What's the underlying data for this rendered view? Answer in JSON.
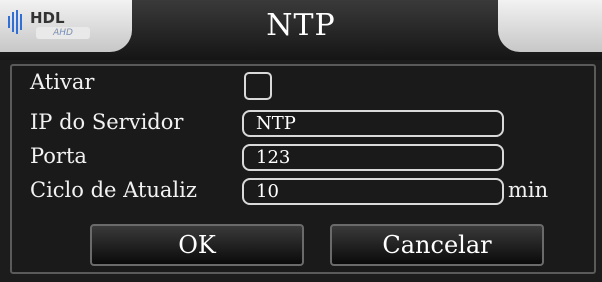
{
  "header": {
    "logo_text": "HDL",
    "logo_sub": "AHD",
    "title": "NTP"
  },
  "form": {
    "enable_label": "Ativar",
    "enable_checked": false,
    "server_label": "IP do Servidor",
    "server_value": "NTP",
    "port_label": "Porta",
    "port_value": "123",
    "cycle_label": "Ciclo de Atualiz",
    "cycle_value": "10",
    "cycle_unit": "min"
  },
  "buttons": {
    "ok_label": "OK",
    "cancel_label": "Cancelar"
  }
}
